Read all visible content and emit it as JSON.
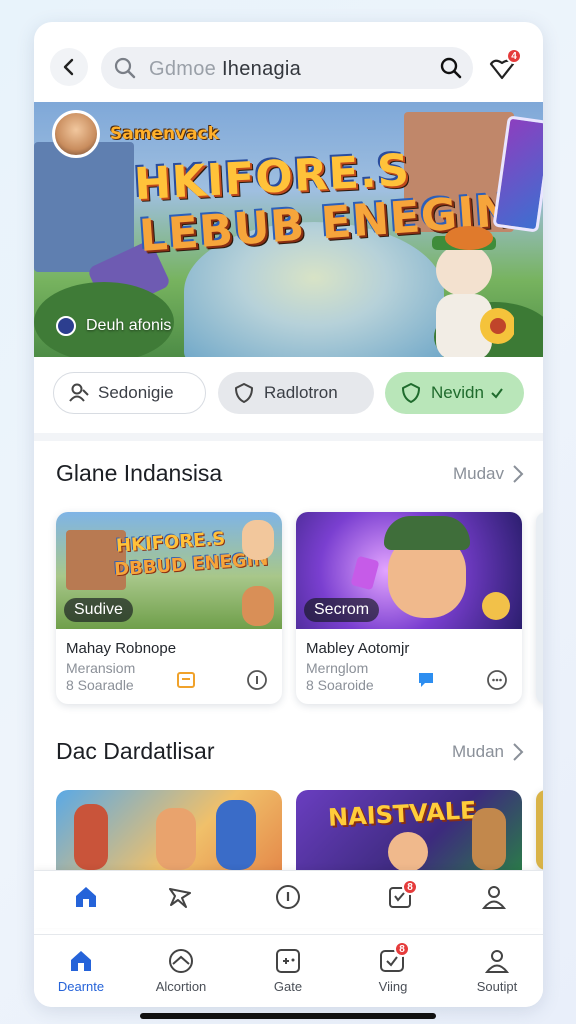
{
  "colors": {
    "accent": "#2563d9",
    "chip_active_bg": "#b9e6b9",
    "chip_active_fg": "#1f6b2d",
    "badge": "#e53b3b"
  },
  "topbar": {
    "back_icon": "chevron-left-icon",
    "search": {
      "placeholder_part": "Gdmoe",
      "value_part": "Ihenagia",
      "icon": "search-icon"
    },
    "notification": {
      "icon": "heart-bell-icon",
      "badge": "4"
    }
  },
  "hero": {
    "username": "Samenvack",
    "title_line1": "HKIFORE.S",
    "title_line2": "LEBUB ENEGIN",
    "subtitle": "Deuh afonis"
  },
  "chips": [
    {
      "label": "Sedonigie",
      "icon": "user-icon",
      "active": false
    },
    {
      "label": "Radlotron",
      "icon": "shield-icon",
      "active": false
    },
    {
      "label": "Nevidn",
      "icon": "shield-check-icon",
      "active": true
    }
  ],
  "section1": {
    "title": "Glane Indansisa",
    "more": "Mudav",
    "cards": [
      {
        "tag": "Sudive",
        "title": "Mahay Robnope",
        "line2": "Meransiom",
        "line3": "8 Soaradle"
      },
      {
        "tag": "Secrom",
        "title": "Mabley Aotomjr",
        "line2": "Mernglom",
        "line3": "8 Soaroide"
      }
    ]
  },
  "section2": {
    "title": "Dac Dardatlisar",
    "more": "Mudan",
    "cards": [
      {
        "banner_text": ""
      },
      {
        "banner_text": "NAISTVALE"
      }
    ]
  },
  "tabbar_top": [
    "home-icon",
    "star-icon",
    "info-icon",
    "calendar-icon",
    "user-icon"
  ],
  "tabbar_top_badge": "8",
  "tabbar": [
    {
      "label": "Dearnte",
      "icon": "home-icon",
      "active": true
    },
    {
      "label": "Alcortion",
      "icon": "controller-icon",
      "active": false
    },
    {
      "label": "Gate",
      "icon": "gamepad-icon",
      "active": false
    },
    {
      "label": "Viing",
      "icon": "notification-icon",
      "active": false,
      "badge": "8"
    },
    {
      "label": "Soutipt",
      "icon": "user-icon",
      "active": false
    }
  ]
}
